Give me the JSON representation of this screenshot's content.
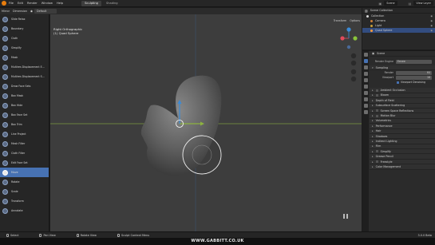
{
  "topbar": {
    "menu": [
      "File",
      "Edit",
      "Render",
      "Window",
      "Help"
    ],
    "tabs": [
      {
        "label": "Sculpting",
        "active": true
      },
      {
        "label": "Shading",
        "active": false
      }
    ],
    "scene_label": "Scene",
    "view_layer_label": "View Layer"
  },
  "subbar": {
    "mode": "Mirror",
    "dimension": "Dimension",
    "brush": "Default"
  },
  "tools": [
    "Slide Relax",
    "Boundary",
    "Cloth",
    "Simplify",
    "Mask",
    "Multires Displacement E...",
    "Multires Displacement S...",
    "Draw Face Sets",
    "Box Mask",
    "Box Hide",
    "Box Face Set",
    "Box Trim",
    "Line Project",
    "Mesh Filter",
    "Cloth Filter",
    "Edit Face Set",
    "Move",
    "Rotate",
    "Scale",
    "Transform",
    "Annotate"
  ],
  "active_tool": "Move",
  "viewport": {
    "view_name": "Right Orthographic",
    "object_name": "(1) Quad Sphere",
    "header_right": [
      "Transform",
      "Options"
    ],
    "gizmo": {
      "x_color": "#e04a5a",
      "y_color": "#8ac43a",
      "z_color": "#3a8bd8"
    }
  },
  "outliner": {
    "title": "Scene Collection",
    "items": [
      {
        "label": "Collection",
        "color": "#d9d9d9",
        "selected": false
      },
      {
        "label": "Camera",
        "color": "#cc7f3a",
        "selected": false
      },
      {
        "label": "Light",
        "color": "#cca13a",
        "selected": false
      },
      {
        "label": "Quad Sphere",
        "color": "#ff9c3a",
        "selected": true
      }
    ]
  },
  "properties": {
    "scene_label": "Scene",
    "render_engine_label": "Render Engine",
    "render_engine_value": "Eevee",
    "sampling": {
      "title": "Sampling",
      "render_label": "Render",
      "render_value": "64",
      "viewport_label": "Viewport",
      "viewport_value": "16",
      "denoise_label": "Viewport Denoising"
    },
    "panels": [
      {
        "label": "Ambient Occlusion",
        "checkbox": true
      },
      {
        "label": "Bloom",
        "checkbox": true
      },
      {
        "label": "Depth of Field",
        "checkbox": false
      },
      {
        "label": "Subsurface Scattering",
        "checkbox": false
      },
      {
        "label": "Screen Space Reflections",
        "checkbox": true
      },
      {
        "label": "Motion Blur",
        "checkbox": true
      },
      {
        "label": "Volumetrics",
        "checkbox": false
      },
      {
        "label": "Performance",
        "checkbox": false
      },
      {
        "label": "Hair",
        "checkbox": false
      },
      {
        "label": "Shadows",
        "checkbox": false
      },
      {
        "label": "Indirect Lighting",
        "checkbox": false
      },
      {
        "label": "Film",
        "checkbox": false
      },
      {
        "label": "Simplify",
        "checkbox": true
      },
      {
        "label": "Grease Pencil",
        "checkbox": false
      },
      {
        "label": "Freestyle",
        "checkbox": true
      },
      {
        "label": "Color Management",
        "checkbox": false
      }
    ]
  },
  "statusbar": {
    "items": [
      "Select",
      "Pan View",
      "Rotate View",
      "Sculpt Context Menu"
    ],
    "version": "3.0.0 Beta"
  },
  "watermark": "WWW.GABBITT.CO.UK",
  "colors": {
    "accent": "#4772b3",
    "viewport_bg": "#3d3d3d",
    "grid_x": "#b84452",
    "grid_y": "#8db33f"
  }
}
